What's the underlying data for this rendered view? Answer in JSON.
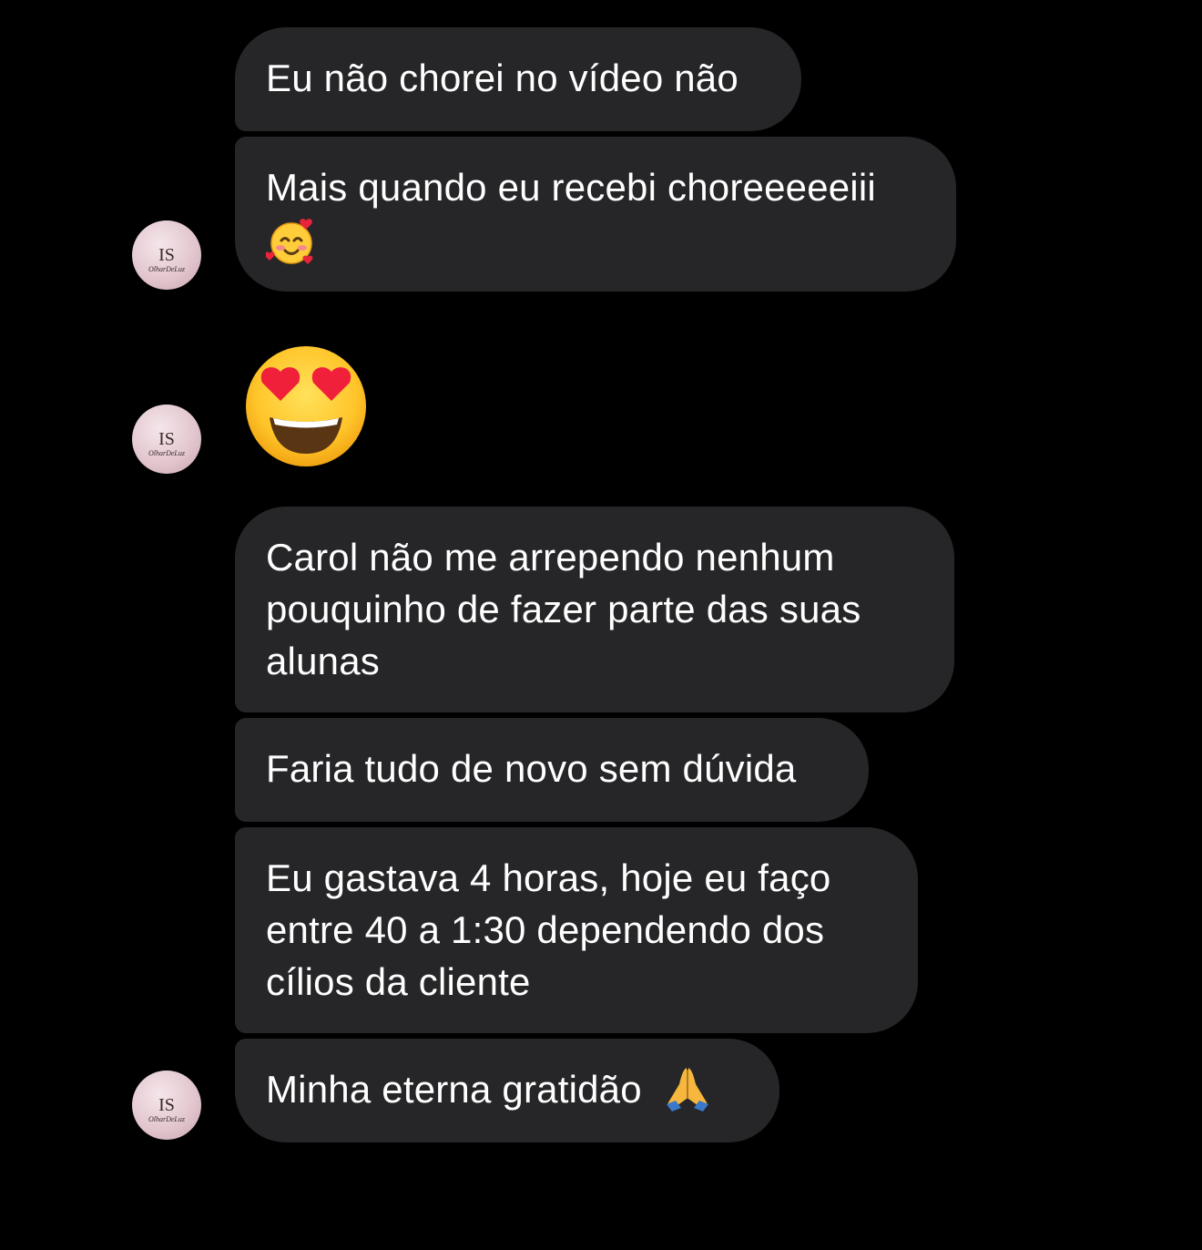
{
  "contact": {
    "avatar_monogram": "IS",
    "avatar_caption": "OlharDeLuz"
  },
  "messages": [
    {
      "text": "Eu não chorei no vídeo não"
    },
    {
      "lines": [
        "Mais quando eu recebi choreeeeeiii"
      ],
      "emoji": "smiling-face-with-hearts"
    },
    {
      "emoji": "heart-eyes-face"
    },
    {
      "lines": [
        "Carol não me arrependo nenhum",
        "pouquinho de fazer parte das suas",
        "alunas"
      ]
    },
    {
      "text": "Faria tudo de novo sem dúvida"
    },
    {
      "lines": [
        "Eu gastava 4 horas, hoje eu faço",
        "entre 40 a 1:30 dependendo dos",
        "cílios da cliente"
      ]
    },
    {
      "text": "Minha eterna gratidão",
      "emoji": "folded-hands"
    }
  ],
  "colors": {
    "background": "#000000",
    "bubble": "#262628",
    "text": "#ffffff"
  }
}
